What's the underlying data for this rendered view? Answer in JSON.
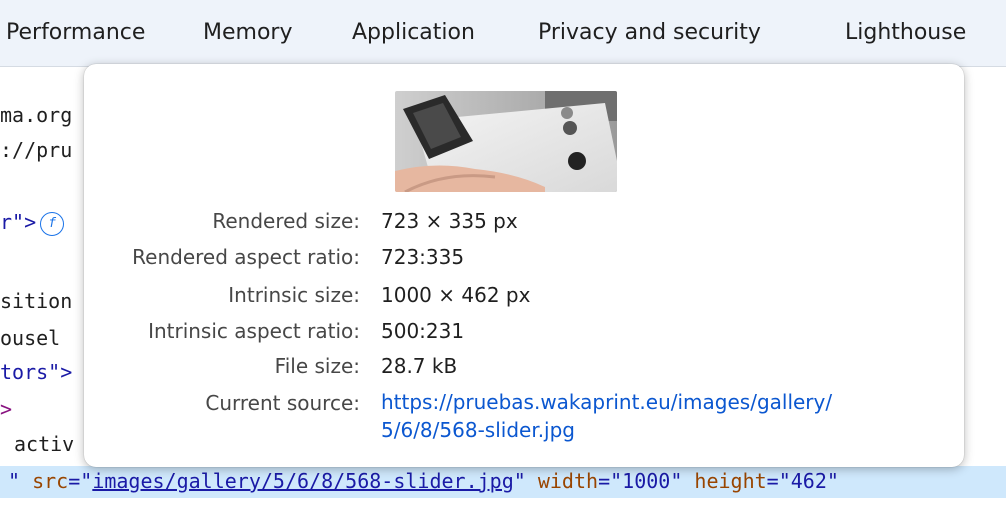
{
  "tabs": [
    "Performance",
    "Memory",
    "Application",
    "Privacy and security",
    "Lighthouse"
  ],
  "code_lines": [
    "ma.org",
    "://pru",
    "r\">",
    "sition",
    "ousel",
    "tors\">",
    ">",
    "activ"
  ],
  "selected_line": {
    "quote_prefix": "\"",
    "attr_src": "src",
    "eq1": "=\"",
    "src_value": "images/gallery/5/6/8/568-slider.jpg",
    "q1": "\"",
    "attr_width": "width",
    "eq2": "=\"",
    "width_value": "1000",
    "q2": "\"",
    "attr_height": "height",
    "eq3": "=\"",
    "height_value": "462",
    "q3": "\""
  },
  "badge_icon": "flex-badge-icon",
  "tooltip": {
    "rows": [
      {
        "label": "Rendered size:",
        "value": "723 × 335 px"
      },
      {
        "label": "Rendered aspect ratio:",
        "value": "723:335"
      },
      {
        "label": "Intrinsic size:",
        "value": "1000 × 462 px"
      },
      {
        "label": "Intrinsic aspect ratio:",
        "value": "500:231"
      },
      {
        "label": "File size:",
        "value": "28.7 kB"
      }
    ],
    "current_source_label": "Current source:",
    "current_source_line1": "https://pruebas.wakaprint.eu/images/gallery/",
    "current_source_line2": "5/6/8/568-slider.jpg"
  },
  "colors": {
    "tab_bar": "#eef3fa",
    "link": "#0b57d0",
    "selected_row": "#cfe8fc"
  }
}
